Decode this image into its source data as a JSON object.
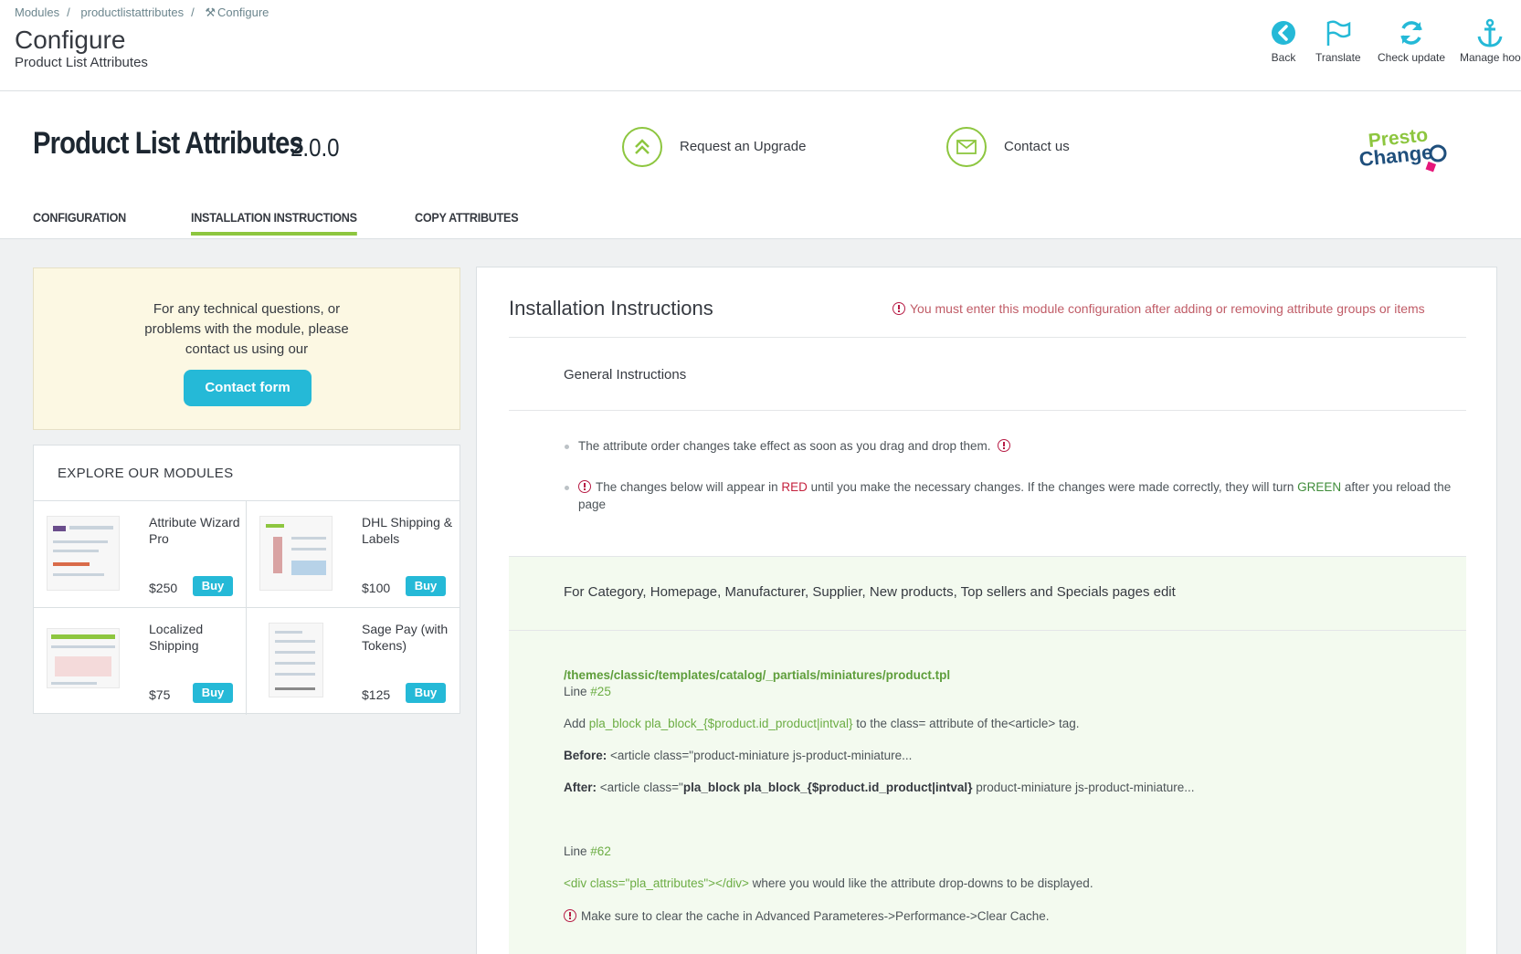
{
  "breadcrumb": {
    "items": [
      "Modules",
      "productlistattributes",
      "Configure"
    ]
  },
  "header": {
    "title": "Configure",
    "subtitle": "Product List Attributes"
  },
  "toolbar": {
    "back": "Back",
    "translate": "Translate",
    "check_update": "Check update",
    "manage_hooks": "Manage hoo"
  },
  "colors": {
    "accent": "#25b9d7",
    "green": "#8dc63f",
    "warning": "#c4213d"
  },
  "module": {
    "name": "Product List Attributes",
    "version": "2.0.0",
    "request_upgrade": "Request an Upgrade",
    "contact_us": "Contact us",
    "logo_text": "Presto Changeo"
  },
  "tabs": [
    {
      "label": "CONFIGURATION"
    },
    {
      "label": "INSTALLATION INSTRUCTIONS",
      "active": true
    },
    {
      "label": "COPY ATTRIBUTES"
    }
  ],
  "help": {
    "line1": "For any technical questions, or",
    "line2": "problems with the module, please",
    "line3": "contact us using our",
    "button": "Contact form"
  },
  "explore": {
    "title": "EXPLORE OUR MODULES",
    "buy_label": "Buy",
    "modules": [
      {
        "name": "Attribute Wizard Pro",
        "price": "$250"
      },
      {
        "name": "DHL Shipping & Labels",
        "price": "$100"
      },
      {
        "name": "Localized Shipping",
        "price": "$75"
      },
      {
        "name": "Sage Pay (with Tokens)",
        "price": "$125"
      }
    ]
  },
  "instructions": {
    "title": "Installation Instructions",
    "warning": "You must enter this module configuration after adding or removing attribute groups or items",
    "general_title": "General Instructions",
    "bullet1": "The attribute order changes take effect as soon as you drag and drop them.",
    "bullet2_a": "The changes below will appear in ",
    "bullet2_red": "RED",
    "bullet2_b": " until you make the necessary changes. If the changes were made correctly, they will turn ",
    "bullet2_green": "GREEN",
    "bullet2_c": " after you reload the page",
    "category_title": "For Category, Homepage, Manufacturer, Supplier, New products, Top sellers and Specials pages edit",
    "file_path": "/themes/classic/templates/catalog/_partials/miniatures/product.tpl",
    "line_label": "Line",
    "line1_num": "#25",
    "add_prefix": "Add ",
    "add_code": "pla_block pla_block_{$product.id_product|intval}",
    "add_suffix": " to the class= attribute of the<article> tag.",
    "before_label": "Before:",
    "before_code": " <article class=\"product-miniature js-product-miniature...",
    "after_label": "After:",
    "after_code_a": " <article class=\"",
    "after_code_b": "pla_block pla_block_{$product.id_product|intval}",
    "after_code_c": " product-miniature js-product-miniature...",
    "line2_num": "#62",
    "div_code": "<div class=\"pla_attributes\"></div>",
    "div_suffix": " where you would like the attribute drop-downs to be displayed.",
    "cache_note": "Make sure to clear the cache in Advanced Parameteres->Performance->Clear Cache."
  }
}
